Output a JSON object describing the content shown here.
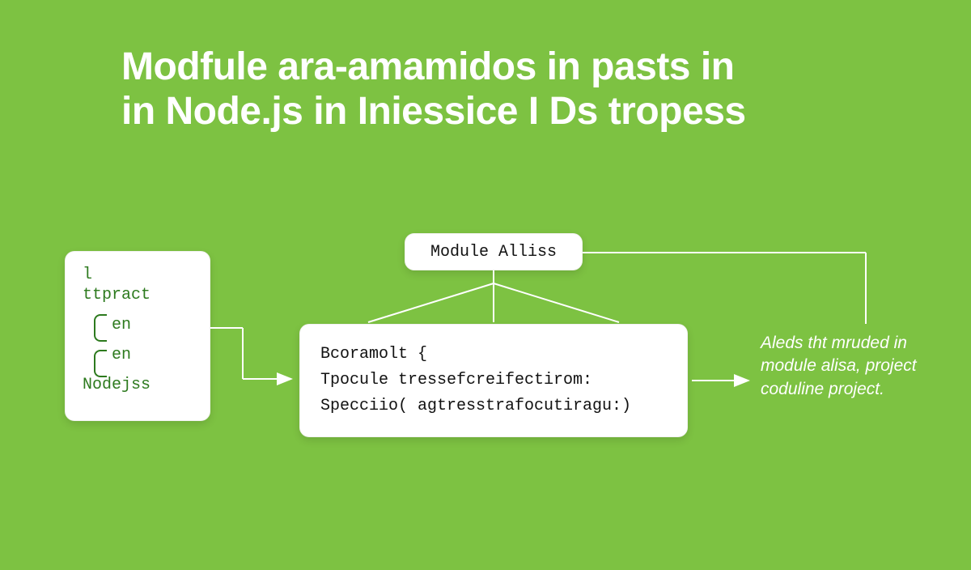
{
  "title": {
    "line1": "Modfule ara-amamidos in pasts in",
    "line2": "in Node.js in Iniessice I Ds tropess"
  },
  "left_card": {
    "l1": "l",
    "l2": "ttpract",
    "en1": "en",
    "en2": "en",
    "bottom": "Nodejss"
  },
  "module_label": "Module Alliss",
  "center_code": {
    "l1": "Bcoramolt {",
    "l2": "Tpocule tressefcreifectirom:",
    "l3": "Specciio( agtresstrafocutiragu:)"
  },
  "caption": "Aleds tht mruded in module alisa, project coduline project."
}
